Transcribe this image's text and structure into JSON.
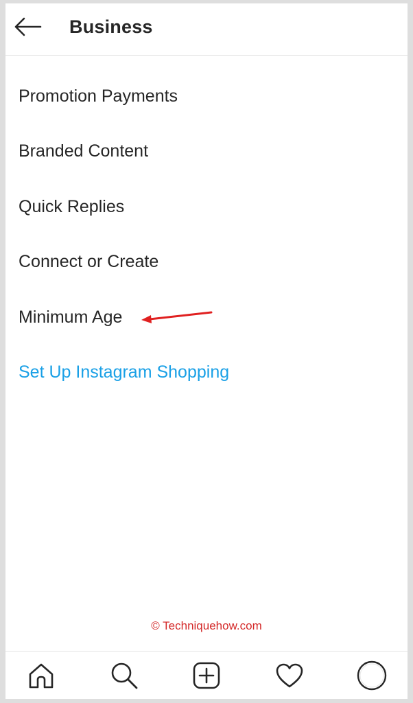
{
  "header": {
    "back_icon": "arrow-left-icon",
    "title": "Business"
  },
  "menu": {
    "items": [
      {
        "label": "Promotion Payments"
      },
      {
        "label": "Branded Content"
      },
      {
        "label": "Quick Replies"
      },
      {
        "label": "Connect or Create"
      },
      {
        "label": "Minimum Age"
      }
    ],
    "link": {
      "label": "Set Up Instagram Shopping",
      "color": "#1aa0e6"
    }
  },
  "annotation": {
    "icon": "red-arrow-icon",
    "color": "#e02020"
  },
  "watermark": {
    "text": "© Techniquehow.com",
    "color": "#d42a2a"
  },
  "tabbar": {
    "tabs": [
      {
        "icon": "home-icon"
      },
      {
        "icon": "search-icon"
      },
      {
        "icon": "add-post-icon"
      },
      {
        "icon": "heart-icon"
      },
      {
        "icon": "profile-icon"
      }
    ]
  }
}
